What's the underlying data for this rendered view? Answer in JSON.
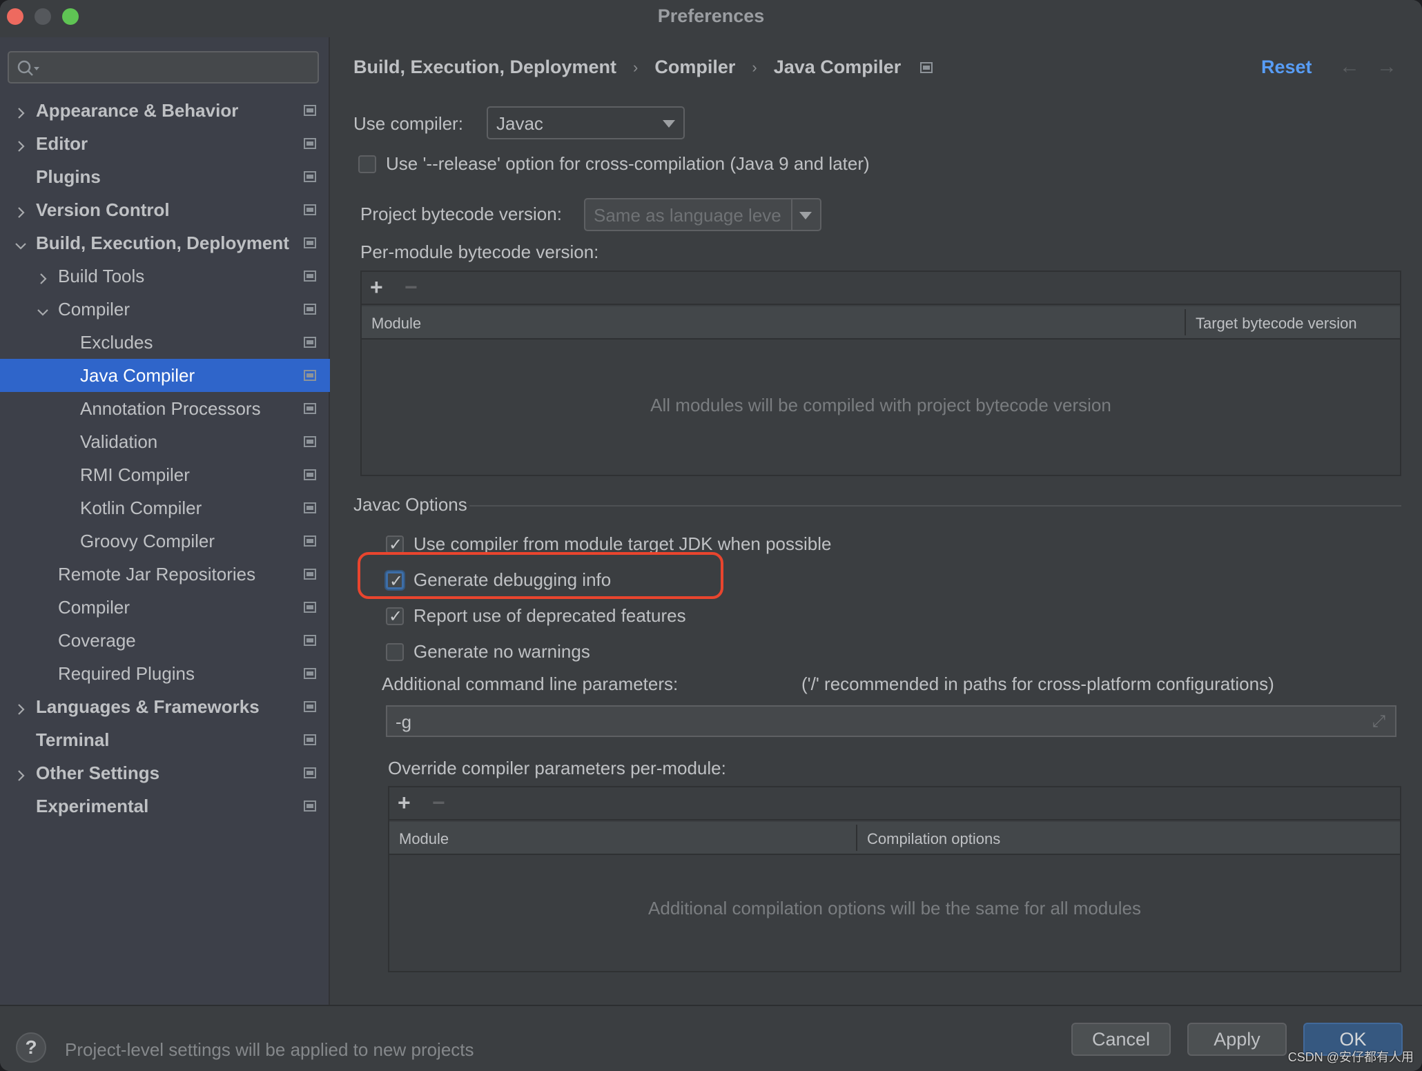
{
  "window": {
    "title": "Preferences"
  },
  "sidebar": {
    "search": {
      "placeholder": "",
      "value": ""
    },
    "items": [
      {
        "label": "Appearance & Behavior",
        "level": 0,
        "bold": true,
        "expander": "collapsed",
        "selected": false
      },
      {
        "label": "Editor",
        "level": 0,
        "bold": true,
        "expander": "collapsed",
        "selected": false
      },
      {
        "label": "Plugins",
        "level": 0,
        "bold": true,
        "expander": "none",
        "selected": false
      },
      {
        "label": "Version Control",
        "level": 0,
        "bold": true,
        "expander": "collapsed",
        "selected": false
      },
      {
        "label": "Build, Execution, Deployment",
        "level": 0,
        "bold": true,
        "expander": "expanded",
        "selected": false
      },
      {
        "label": "Build Tools",
        "level": 1,
        "bold": false,
        "expander": "collapsed",
        "selected": false
      },
      {
        "label": "Compiler",
        "level": 1,
        "bold": false,
        "expander": "expanded",
        "selected": false
      },
      {
        "label": "Excludes",
        "level": 2,
        "bold": false,
        "expander": "none",
        "selected": false
      },
      {
        "label": "Java Compiler",
        "level": 2,
        "bold": false,
        "expander": "none",
        "selected": true
      },
      {
        "label": "Annotation Processors",
        "level": 2,
        "bold": false,
        "expander": "none",
        "selected": false
      },
      {
        "label": "Validation",
        "level": 2,
        "bold": false,
        "expander": "none",
        "selected": false
      },
      {
        "label": "RMI Compiler",
        "level": 2,
        "bold": false,
        "expander": "none",
        "selected": false
      },
      {
        "label": "Kotlin Compiler",
        "level": 2,
        "bold": false,
        "expander": "none",
        "selected": false
      },
      {
        "label": "Groovy Compiler",
        "level": 2,
        "bold": false,
        "expander": "none",
        "selected": false
      },
      {
        "label": "Remote Jar Repositories",
        "level": 1,
        "bold": false,
        "expander": "none",
        "selected": false
      },
      {
        "label": "Compiler",
        "level": 1,
        "bold": false,
        "expander": "none",
        "selected": false
      },
      {
        "label": "Coverage",
        "level": 1,
        "bold": false,
        "expander": "none",
        "selected": false
      },
      {
        "label": "Required Plugins",
        "level": 1,
        "bold": false,
        "expander": "none",
        "selected": false
      },
      {
        "label": "Languages & Frameworks",
        "level": 0,
        "bold": true,
        "expander": "collapsed",
        "selected": false
      },
      {
        "label": "Terminal",
        "level": 0,
        "bold": true,
        "expander": "none",
        "selected": false
      },
      {
        "label": "Other Settings",
        "level": 0,
        "bold": true,
        "expander": "collapsed",
        "selected": false
      },
      {
        "label": "Experimental",
        "level": 0,
        "bold": true,
        "expander": "none",
        "selected": false
      }
    ]
  },
  "header": {
    "breadcrumb": [
      "Build, Execution, Deployment",
      "Compiler",
      "Java Compiler"
    ],
    "separator": "›",
    "reset_label": "Reset",
    "back_icon": "←",
    "forward_icon": "→"
  },
  "compiler": {
    "use_compiler_label": "Use compiler:",
    "use_compiler_value": "Javac",
    "release_option_label": "Use '--release' option for cross-compilation (Java 9 and later)",
    "release_option_checked": false,
    "bytecode_label": "Project bytecode version:",
    "bytecode_value": "Same as language leve",
    "per_module_label": "Per-module bytecode version:",
    "per_module_table": {
      "add": "+",
      "remove": "−",
      "columns": [
        "Module",
        "Target bytecode version"
      ],
      "empty_text": "All modules will be compiled with project bytecode version"
    }
  },
  "javac": {
    "group_title": "Javac Options",
    "options": [
      {
        "label": "Use compiler from module target JDK when possible",
        "checked": true
      },
      {
        "label": "Generate debugging info",
        "checked": true,
        "focused": true,
        "highlighted": true
      },
      {
        "label": "Report use of deprecated features",
        "checked": true
      },
      {
        "label": "Generate no warnings",
        "checked": false
      }
    ],
    "cmdline_label": "Additional command line parameters:",
    "cmdline_hint": "('/' recommended in paths for cross-platform configurations)",
    "cmdline_value": "-g",
    "override_label": "Override compiler parameters per-module:",
    "override_table": {
      "add": "+",
      "remove": "−",
      "columns": [
        "Module",
        "Compilation options"
      ],
      "empty_text": "Additional compilation options will be the same for all modules"
    }
  },
  "footer": {
    "help": "?",
    "message": "Project-level settings will be applied to new projects",
    "cancel": "Cancel",
    "apply": "Apply",
    "ok": "OK"
  },
  "watermark": "CSDN @安仔都有人用",
  "colors": {
    "accent": "#2f65ca",
    "link": "#589df6",
    "highlight_ring": "#e9452e",
    "primary_button": "#365880"
  }
}
